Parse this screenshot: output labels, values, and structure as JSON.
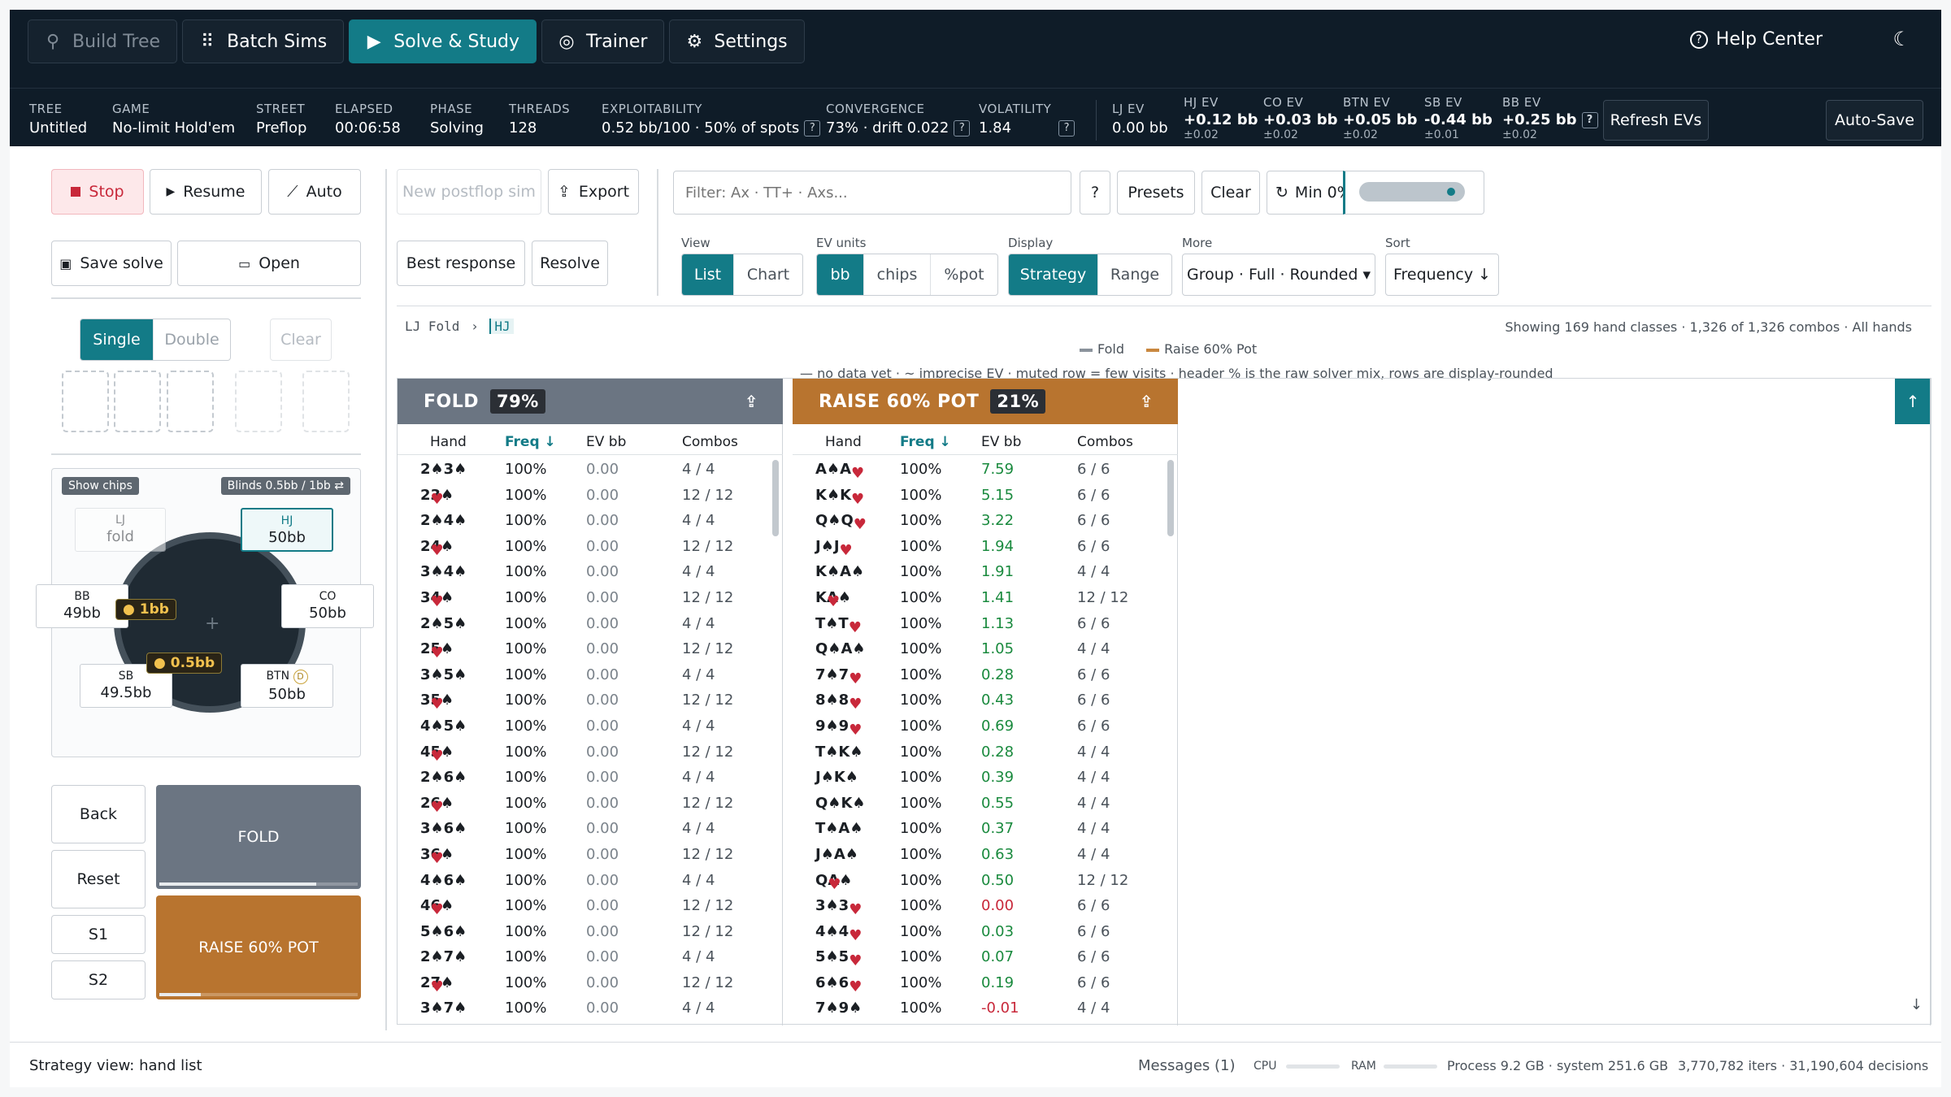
{
  "nav": [
    {
      "label": "Build Tree",
      "icon": "tree-icon",
      "state": "disabled"
    },
    {
      "label": "Batch Sims",
      "icon": "grid-icon",
      "state": "normal"
    },
    {
      "label": "Solve & Study",
      "icon": "play-icon",
      "state": "active"
    },
    {
      "label": "Trainer",
      "icon": "target-icon",
      "state": "normal"
    },
    {
      "label": "Settings",
      "icon": "gear-icon",
      "state": "normal"
    }
  ],
  "help_label": "Help Center",
  "stats": {
    "tree": {
      "k": "TREE",
      "v": "Untitled"
    },
    "game": {
      "k": "GAME",
      "v": "No-limit Hold'em"
    },
    "street": {
      "k": "STREET",
      "v": "Preflop"
    },
    "elapsed": {
      "k": "ELAPSED",
      "v": "00:06:58"
    },
    "phase": {
      "k": "PHASE",
      "v": "Solving"
    },
    "threads": {
      "k": "THREADS",
      "v": "128"
    },
    "exploit": {
      "k": "EXPLOITABILITY",
      "v": "0.52 bb/100 · 50% of spots"
    },
    "conv": {
      "k": "CONVERGENCE",
      "v": "73% · drift 0.022"
    },
    "vol": {
      "k": "VOLATILITY",
      "v": "1.84"
    },
    "lj": {
      "k": "LJ EV",
      "v": "0.00 bb"
    },
    "hj": {
      "k": "HJ EV",
      "v": "+0.12 bb",
      "s": "±0.02"
    },
    "co": {
      "k": "CO EV",
      "v": "+0.03 bb",
      "s": "±0.02"
    },
    "btn": {
      "k": "BTN EV",
      "v": "+0.05 bb",
      "s": "±0.02"
    },
    "sb": {
      "k": "SB EV",
      "v": "-0.44 bb",
      "s": "±0.01"
    },
    "bb": {
      "k": "BB EV",
      "v": "+0.25 bb",
      "s": "±0.02"
    },
    "q": "?"
  },
  "top_buttons": {
    "refresh": "Refresh EVs",
    "autosave": "Auto-Save"
  },
  "controls": {
    "stop": "Stop",
    "resume": "Resume",
    "auto": "Auto",
    "save": "Save solve",
    "open": "Open",
    "new_postflop": "New postflop sim",
    "export": "Export",
    "best_response": "Best response",
    "resolve": "Resolve",
    "filter_placeholder": "Filter: Ax · TT+ · Axs...",
    "q": "?",
    "presets": "Presets",
    "clear": "Clear",
    "min": "Min 0%"
  },
  "board": {
    "single": "Single",
    "double": "Double",
    "clear": "Clear"
  },
  "view": {
    "label": "View",
    "options": [
      "List",
      "Chart"
    ],
    "selected": "List"
  },
  "evunits": {
    "label": "EV units",
    "options": [
      "bb",
      "chips",
      "%pot"
    ],
    "selected": "bb"
  },
  "display": {
    "label": "Display",
    "options": [
      "Strategy",
      "Range"
    ],
    "selected": "Strategy"
  },
  "more": {
    "label": "More",
    "value": "Group · Full · Rounded ▾"
  },
  "sort": {
    "label": "Sort",
    "value": "Frequency ↓"
  },
  "breadcrumb": {
    "first": "LJ Fold",
    "sep": "›",
    "current": "HJ"
  },
  "showing": "Showing 169 hand classes · 1,326 of 1,326 combos · All hands",
  "legend": {
    "fold": "Fold",
    "raise": "Raise 60% Pot"
  },
  "note": "— no data yet · ~ imprecise EV · muted row = few visits · header % is the raw solver mix, rows are display-rounded",
  "table": {
    "show_chips": "Show chips",
    "blinds": "Blinds 0.5bb / 1bb ⇄",
    "seats": [
      {
        "id": "lj",
        "name": "LJ",
        "stack": "fold"
      },
      {
        "id": "hj",
        "name": "HJ",
        "stack": "50bb"
      },
      {
        "id": "co",
        "name": "CO",
        "stack": "50bb"
      },
      {
        "id": "btn",
        "name": "BTN",
        "stack": "50bb"
      },
      {
        "id": "sb",
        "name": "SB",
        "stack": "49.5bb"
      },
      {
        "id": "bb",
        "name": "BB",
        "stack": "49bb"
      }
    ],
    "dealer": "D",
    "chip_bb": "1bb",
    "chip_sb": "0.5bb"
  },
  "actions": {
    "back": "Back",
    "reset": "Reset",
    "s1": "S1",
    "s2": "S2",
    "fold": {
      "label": "FOLD",
      "freq": 0.79,
      "color": "#6b7582"
    },
    "raise": {
      "label": "RAISE 60% POT",
      "freq": 0.21,
      "color": "#b8742f"
    }
  },
  "columns_header": {
    "hand": "Hand",
    "freq": "Freq ↓",
    "ev": "EV bb",
    "combos": "Combos"
  },
  "fold_col": {
    "title": "FOLD",
    "pct": "79%",
    "color": "#6b7582",
    "rows": [
      [
        "2♠3♠",
        "100%",
        "0.00",
        "4 / 4"
      ],
      [
        "2♥3♠",
        "100%",
        "0.00",
        "12 / 12"
      ],
      [
        "2♠4♠",
        "100%",
        "0.00",
        "4 / 4"
      ],
      [
        "2♥4♠",
        "100%",
        "0.00",
        "12 / 12"
      ],
      [
        "3♠4♠",
        "100%",
        "0.00",
        "4 / 4"
      ],
      [
        "3♥4♠",
        "100%",
        "0.00",
        "12 / 12"
      ],
      [
        "2♠5♠",
        "100%",
        "0.00",
        "4 / 4"
      ],
      [
        "2♥5♠",
        "100%",
        "0.00",
        "12 / 12"
      ],
      [
        "3♠5♠",
        "100%",
        "0.00",
        "4 / 4"
      ],
      [
        "3♥5♠",
        "100%",
        "0.00",
        "12 / 12"
      ],
      [
        "4♠5♠",
        "100%",
        "0.00",
        "4 / 4"
      ],
      [
        "4♥5♠",
        "100%",
        "0.00",
        "12 / 12"
      ],
      [
        "2♠6♠",
        "100%",
        "0.00",
        "4 / 4"
      ],
      [
        "2♥6♠",
        "100%",
        "0.00",
        "12 / 12"
      ],
      [
        "3♠6♠",
        "100%",
        "0.00",
        "4 / 4"
      ],
      [
        "3♥6♠",
        "100%",
        "0.00",
        "12 / 12"
      ],
      [
        "4♠6♠",
        "100%",
        "0.00",
        "4 / 4"
      ],
      [
        "4♥6♠",
        "100%",
        "0.00",
        "12 / 12"
      ],
      [
        "5♠6♠",
        "100%",
        "0.00",
        "12 / 12"
      ],
      [
        "2♠7♠",
        "100%",
        "0.00",
        "4 / 4"
      ],
      [
        "2♥7♠",
        "100%",
        "0.00",
        "12 / 12"
      ],
      [
        "3♠7♠",
        "100%",
        "0.00",
        "4 / 4"
      ]
    ]
  },
  "raise_col": {
    "title": "RAISE 60% POT",
    "pct": "21%",
    "color": "#b8742f",
    "rows": [
      [
        "A♠A♥",
        "100%",
        "7.59",
        "6 / 6"
      ],
      [
        "K♠K♥",
        "100%",
        "5.15",
        "6 / 6"
      ],
      [
        "Q♠Q♥",
        "100%",
        "3.22",
        "6 / 6"
      ],
      [
        "J♠J♥",
        "100%",
        "1.94",
        "6 / 6"
      ],
      [
        "K♠A♠",
        "100%",
        "1.91",
        "4 / 4"
      ],
      [
        "K♥A♠",
        "100%",
        "1.41",
        "12 / 12"
      ],
      [
        "T♠T♥",
        "100%",
        "1.13",
        "6 / 6"
      ],
      [
        "Q♠A♠",
        "100%",
        "1.05",
        "4 / 4"
      ],
      [
        "7♠7♥",
        "100%",
        "0.28",
        "6 / 6"
      ],
      [
        "8♠8♥",
        "100%",
        "0.43",
        "6 / 6"
      ],
      [
        "9♠9♥",
        "100%",
        "0.69",
        "6 / 6"
      ],
      [
        "T♠K♠",
        "100%",
        "0.28",
        "4 / 4"
      ],
      [
        "J♠K♠",
        "100%",
        "0.39",
        "4 / 4"
      ],
      [
        "Q♠K♠",
        "100%",
        "0.55",
        "4 / 4"
      ],
      [
        "T♠A♠",
        "100%",
        "0.37",
        "4 / 4"
      ],
      [
        "J♠A♠",
        "100%",
        "0.63",
        "4 / 4"
      ],
      [
        "Q♥A♠",
        "100%",
        "0.50",
        "12 / 12"
      ],
      [
        "3♠3♥",
        "100%",
        "0.00",
        "6 / 6"
      ],
      [
        "4♠4♥",
        "100%",
        "0.03",
        "6 / 6"
      ],
      [
        "5♠5♥",
        "100%",
        "0.07",
        "6 / 6"
      ],
      [
        "6♠6♥",
        "100%",
        "0.19",
        "6 / 6"
      ],
      [
        "7♠9♠",
        "100%",
        "-0.01",
        "4 / 4"
      ]
    ]
  },
  "footer": {
    "status": "Strategy view: hand list",
    "messages": "Messages (1)",
    "cpu": "CPU",
    "ram": "RAM",
    "process": "Process 9.2 GB · system 251.6 GB",
    "iters": "3,770,782 iters · 31,190,604 decisions"
  }
}
